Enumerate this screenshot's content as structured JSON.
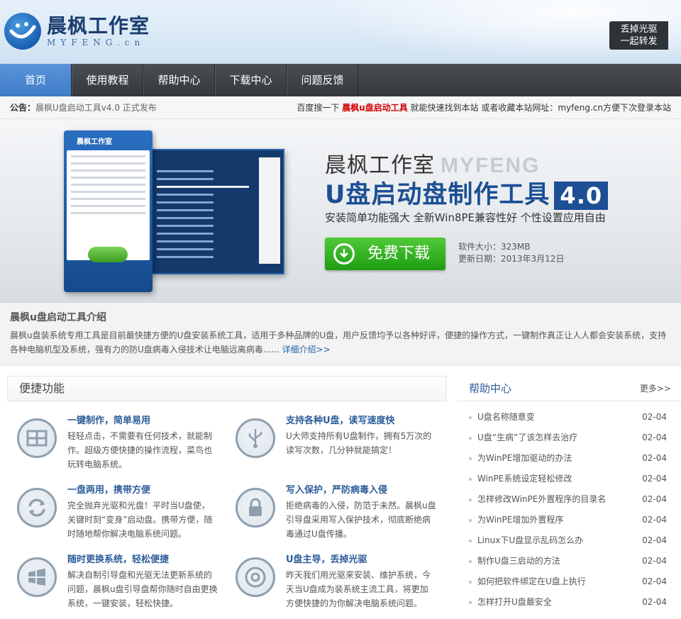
{
  "header": {
    "logo_cn": "晨枫工作室",
    "logo_en": "MYFENG.cn",
    "slogan_line1": "丢掉光驱",
    "slogan_line2": "一起转发"
  },
  "nav": {
    "items": [
      {
        "label": "首页"
      },
      {
        "label": "使用教程"
      },
      {
        "label": "帮助中心"
      },
      {
        "label": "下载中心"
      },
      {
        "label": "问题反馈"
      }
    ]
  },
  "notice": {
    "prefix": "公告：",
    "text": "晨枫U盘启动工具v4.0 正式发布",
    "right_pre": "百度搜一下",
    "right_highlight": "晨枫u盘启动工具",
    "right_post": "就能快速找到本站 或者收藏本站网址：myfeng.cn方便下次登录本站"
  },
  "banner": {
    "title_cn": "晨枫工作室",
    "title_en": "MYFENG",
    "product": "U盘启动盘制作工具",
    "version": "4.0",
    "desc": "安装简单功能强大 全新Win8PE兼容性好 个性设置应用自由",
    "download_label": "免费下载",
    "size_label": "软件大小：323MB",
    "date_label": "更新日期：2013年3月12日"
  },
  "intro": {
    "title": "晨枫u盘启动工具介绍",
    "text": "晨枫u盘装系统专用工具是目前最快捷方便的U盘安装系统工具，适用于多种品牌的U盘，用户反馈均予以各种好评，便捷的操作方式，一键制作真正让人人都会安装系统，支持各种电脑机型及系统，强有力的防U盘病毒入侵技术让电脑远离病毒......",
    "more": "详细介绍>>"
  },
  "features": {
    "heading": "便捷功能",
    "items": [
      {
        "icon": "windows-grid-icon",
        "title": "一键制作，简单易用",
        "desc": "轻轻点击，不需要有任何技术，就能制作。超级方便快捷的操作流程，菜鸟也玩转电脑系统。"
      },
      {
        "icon": "usb-icon",
        "title": "支持各种U盘，读写速度快",
        "desc": "U大师支持所有U盘制作，拥有5万次的读写次数，几分钟就能搞定！"
      },
      {
        "icon": "refresh-icon",
        "title": "一盘两用，携带方便",
        "desc": "完全抛弃光驱和光盘！平时当U盘使，关键时刻“变身”启动盘。携带方便，随时随地帮你解决电脑系统问题。"
      },
      {
        "icon": "lock-icon",
        "title": "写入保护，严防病毒入侵",
        "desc": "拒绝病毒的入侵，防范于未然。晨枫u盘引导盘采用写入保护技术，彻底断绝病毒通过U盘传播。"
      },
      {
        "icon": "windows-flag-icon",
        "title": "随时更换系统，轻松便捷",
        "desc": "解决自制引导盘和光驱无法更新系统的问题，晨枫u盘引导盘帮你随时自由更换系统，一键安装，轻松快捷。"
      },
      {
        "icon": "disc-icon",
        "title": "U盘主导，丢掉光驱",
        "desc": "昨天我们用光驱来安装、维护系统，今天当U盘成为装系统主流工具，将更加方便快捷的为你解决电脑系统问题。"
      }
    ]
  },
  "help": {
    "title": "帮助中心",
    "more": "更多>>",
    "items": [
      {
        "title": "U盘名称随意变",
        "date": "02-04"
      },
      {
        "title": "U盘“生病”了该怎样去治疗",
        "date": "02-04"
      },
      {
        "title": "为WinPE增加驱动的办法",
        "date": "02-04"
      },
      {
        "title": "WinPE系统设定轻松修改",
        "date": "02-04"
      },
      {
        "title": "怎样修改WinPE外置程序的目录名",
        "date": "02-04"
      },
      {
        "title": "为WinPE增加外置程序",
        "date": "02-04"
      },
      {
        "title": "Linux下U盘显示乱码怎么办",
        "date": "02-04"
      },
      {
        "title": "制作U盘三启动的方法",
        "date": "02-04"
      },
      {
        "title": "如何把软件绑定在U盘上执行",
        "date": "02-04"
      },
      {
        "title": "怎样打开U盘最安全",
        "date": "02-04"
      }
    ]
  }
}
